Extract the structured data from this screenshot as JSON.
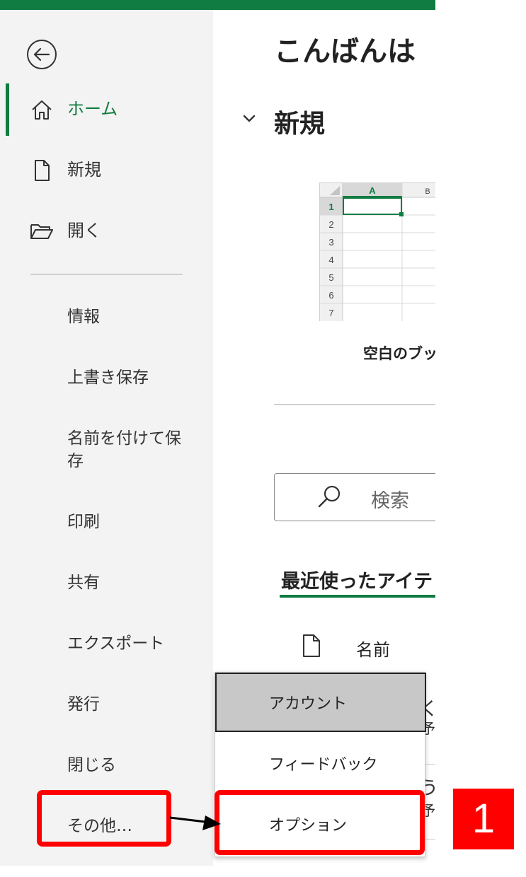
{
  "colors": {
    "accent": "#107c41",
    "highlight": "#ff0000",
    "sidebar_bg": "#f3f3f3"
  },
  "sidebar": {
    "back_icon": "back-arrow-icon",
    "nav": [
      {
        "label": "ホーム",
        "icon": "home-icon",
        "active": true
      },
      {
        "label": "新規",
        "icon": "new-file-icon",
        "active": false
      },
      {
        "label": "開く",
        "icon": "open-folder-icon",
        "active": false
      }
    ],
    "menu": [
      "情報",
      "上書き保存",
      "名前を付けて保\n存",
      "印刷",
      "共有",
      "エクスポート",
      "発行",
      "閉じる",
      "その他…"
    ]
  },
  "main": {
    "greeting": "こんばんは",
    "new_section": "新規",
    "template": {
      "label": "空白のブッ",
      "columns": [
        "A",
        "B"
      ],
      "rows": [
        "1",
        "2",
        "3",
        "4",
        "5",
        "6",
        "7"
      ]
    },
    "search": {
      "placeholder": "検索",
      "icon": "search-icon"
    },
    "recent_tab": "最近使ったアイテ",
    "list_header": {
      "name": "名前",
      "icon": "file-icon"
    },
    "peek": {
      "r1a": "く",
      "r1b": "予",
      "r2a": "う",
      "r2b": "予"
    }
  },
  "popup": {
    "items": [
      {
        "label": "アカウント",
        "selected": true
      },
      {
        "label": "フィードバック",
        "selected": false
      },
      {
        "label": "オプション",
        "selected": false
      }
    ]
  },
  "annotation": {
    "step": "1"
  }
}
